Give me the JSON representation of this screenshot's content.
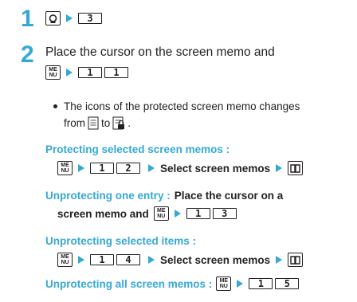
{
  "step1": {
    "number": "1",
    "key": "3"
  },
  "step2": {
    "number": "2",
    "line1": "Place the cursor on the screen memo and",
    "keys": [
      "1",
      "1"
    ],
    "menu_icon": [
      "ME",
      "NU"
    ],
    "bullet_line1": "The icons of the protected screen memo changes",
    "bullet_from": "from",
    "bullet_to": "to"
  },
  "protect_selected": {
    "label": "Protecting selected screen memos :",
    "keys": [
      "1",
      "2"
    ],
    "action": "Select screen memos"
  },
  "unprotect_one": {
    "label": "Unprotecting one entry :",
    "text1": "Place the cursor on a",
    "text2": "screen memo and",
    "keys": [
      "1",
      "3"
    ]
  },
  "unprotect_selected": {
    "label": "Unprotecting selected items :",
    "keys": [
      "1",
      "4"
    ],
    "action": "Select screen memos"
  },
  "unprotect_all": {
    "label": "Unprotecting all screen memos :",
    "keys": [
      "1",
      "5"
    ]
  },
  "colors": {
    "accent": "#35a9d5",
    "text": "#231f20"
  }
}
